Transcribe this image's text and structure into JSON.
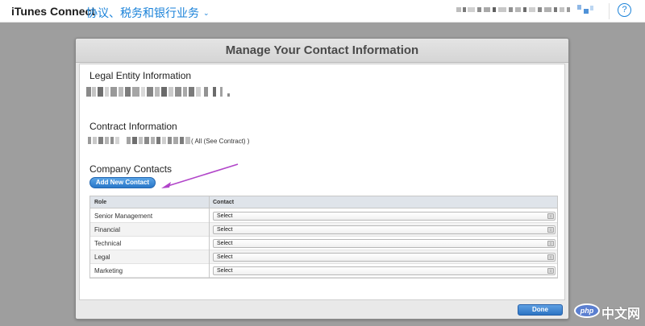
{
  "header": {
    "brand": "iTunes Connect",
    "section": "协议、税务和银行业务",
    "help_label": "?"
  },
  "modal": {
    "title": "Manage Your Contact Information",
    "legal_entity_heading": "Legal Entity Information",
    "contract_heading": "Contract Information",
    "contract_scope": "( All (See Contract) )",
    "company_contacts_heading": "Company Contacts",
    "add_contact_label": "Add New Contact",
    "table": {
      "columns": [
        "Role",
        "Contact"
      ],
      "rows": [
        {
          "role": "Senior Management",
          "contact": "Select"
        },
        {
          "role": "Financial",
          "contact": "Select"
        },
        {
          "role": "Technical",
          "contact": "Select"
        },
        {
          "role": "Legal",
          "contact": "Select"
        },
        {
          "role": "Marketing",
          "contact": "Select"
        }
      ]
    },
    "done_label": "Done"
  },
  "watermark": {
    "logo": "php",
    "text": "中文网"
  },
  "colors": {
    "accent": "#1a82d9",
    "overlay": "#9e9e9e",
    "button_blue": "#2a78c9",
    "arrow": "#b145c9"
  },
  "icons": {
    "dropdown": "chevron-down-icon",
    "help": "question-circle-icon",
    "select_stepper": "updown-icon"
  }
}
